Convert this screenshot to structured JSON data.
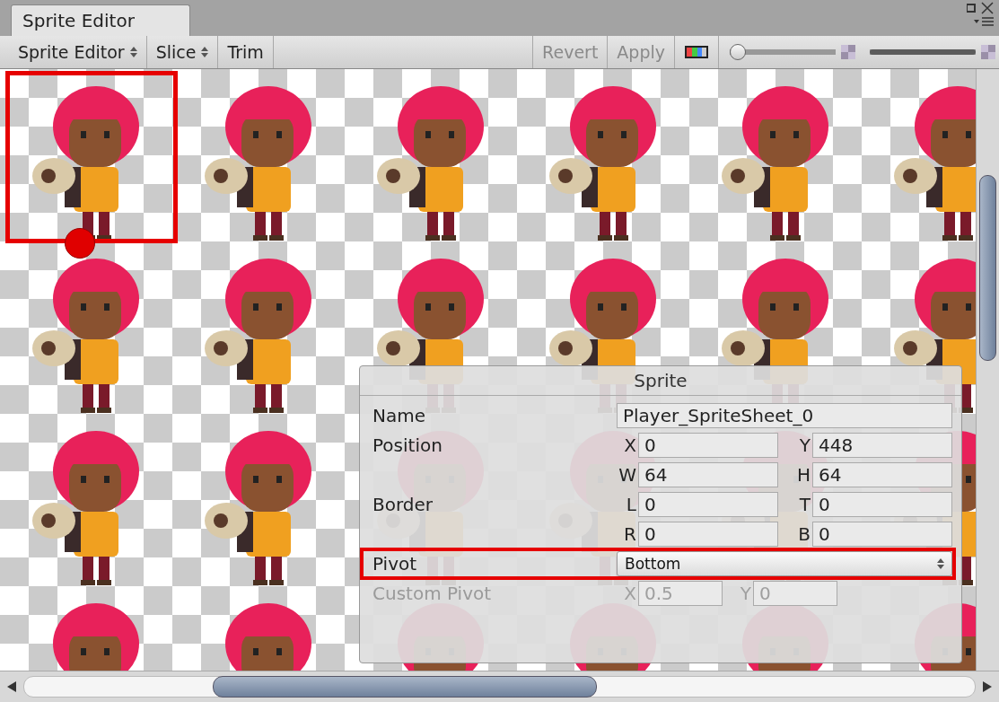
{
  "window": {
    "tab_title": "Sprite Editor"
  },
  "toolbar": {
    "items": [
      {
        "kind": "dropdown",
        "label": "Sprite Editor",
        "disabled": false
      },
      {
        "kind": "dropdown",
        "label": "Slice",
        "disabled": false
      },
      {
        "kind": "button",
        "label": "Trim",
        "disabled": false
      },
      {
        "kind": "spacer"
      },
      {
        "kind": "button",
        "label": "Revert",
        "disabled": true
      },
      {
        "kind": "button",
        "label": "Apply",
        "disabled": true
      },
      {
        "kind": "color-toggle"
      },
      {
        "kind": "slider",
        "level": 0.0
      },
      {
        "kind": "slider",
        "level": 1.0
      }
    ]
  },
  "sprite_sheet": {
    "cells": [
      {
        "selected": true
      },
      {
        "selected": false
      },
      {
        "selected": false
      },
      {
        "selected": false
      },
      {
        "selected": false
      },
      {
        "selected": false
      },
      {
        "selected": false
      },
      {
        "selected": false
      },
      {
        "selected": false
      },
      {
        "selected": false
      },
      {
        "selected": false
      },
      {
        "selected": false
      },
      {
        "selected": false
      },
      {
        "selected": false
      },
      {
        "selected": false
      },
      {
        "selected": false
      },
      {
        "selected": false
      },
      {
        "selected": false
      },
      {
        "selected": false
      },
      {
        "selected": false
      },
      {
        "selected": false
      },
      {
        "selected": false
      },
      {
        "selected": false
      },
      {
        "selected": false
      }
    ]
  },
  "sprite_panel": {
    "title": "Sprite",
    "rows": [
      {
        "kind": "text",
        "label": "Name",
        "value": "Player_SpriteSheet_0",
        "highlighted": false,
        "disabled": false
      },
      {
        "kind": "pair",
        "label": "Position",
        "fields": [
          {
            "axis": "X",
            "value": "0"
          },
          {
            "axis": "Y",
            "value": "448"
          }
        ],
        "highlighted": false,
        "disabled": false
      },
      {
        "kind": "pair",
        "fields": [
          {
            "axis": "W",
            "value": "64"
          },
          {
            "axis": "H",
            "value": "64"
          }
        ],
        "highlighted": false,
        "disabled": false
      },
      {
        "kind": "pair",
        "label": "Border",
        "fields": [
          {
            "axis": "L",
            "value": "0"
          },
          {
            "axis": "T",
            "value": "0"
          }
        ],
        "highlighted": false,
        "disabled": false
      },
      {
        "kind": "pair",
        "fields": [
          {
            "axis": "R",
            "value": "0"
          },
          {
            "axis": "B",
            "value": "0"
          }
        ],
        "highlighted": false,
        "disabled": false
      },
      {
        "kind": "select",
        "label": "Pivot",
        "value": "Bottom",
        "highlighted": true,
        "disabled": false
      },
      {
        "kind": "small-pair",
        "label": "Custom Pivot",
        "fields": [
          {
            "axis": "X",
            "value": "0.5"
          },
          {
            "axis": "Y",
            "value": "0"
          }
        ],
        "highlighted": false,
        "disabled": true
      }
    ]
  }
}
